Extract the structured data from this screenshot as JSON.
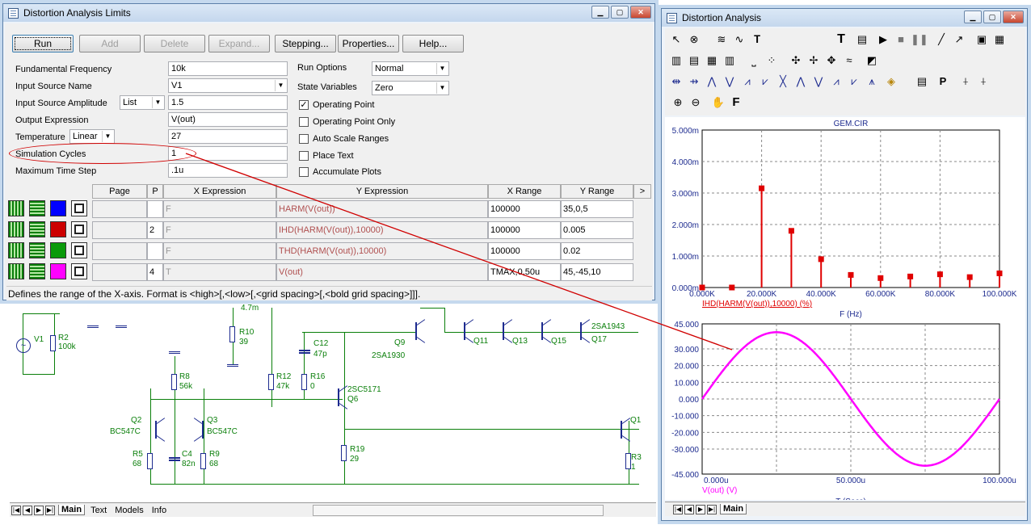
{
  "schematic": {
    "labels": {
      "v1": "V1",
      "r2": "R2",
      "r2v": "100k",
      "r10": "R10",
      "r10v": "39",
      "c12": "C12",
      "c12v": "47p",
      "r8": "R8",
      "r8v": "56k",
      "r12": "R12",
      "r12v": "47k",
      "r16": "R16",
      "r16v": "0",
      "q6": "2SC5171",
      "q6n": "Q6",
      "q9": "Q9",
      "q9v": "2SA1930",
      "q11": "Q11",
      "q13": "Q13",
      "q15": "Q15",
      "q17": "Q17",
      "q17v": "2SA1943",
      "q2": "Q2",
      "q2v": "BC547C",
      "q3": "Q3",
      "q3v": "BC547C",
      "r5": "R5",
      "r5v": "68",
      "c4": "C4",
      "c4v": "82n",
      "r9": "R9",
      "r9v": "68",
      "r19": "R19",
      "r19v": "29",
      "r3": "R3",
      "r3v": "1",
      "q1": "Q1",
      "r4p7": "4.7m"
    },
    "tabs": [
      "Main",
      "Text",
      "Models",
      "Info"
    ]
  },
  "dialog": {
    "title": "Distortion Analysis Limits",
    "buttons": {
      "run": "Run",
      "add": "Add",
      "delete": "Delete",
      "expand": "Expand...",
      "stepping": "Stepping...",
      "properties": "Properties...",
      "help": "Help..."
    },
    "fields": {
      "fundamental_frequency": {
        "label": "Fundamental Frequency",
        "value": "10k"
      },
      "input_source_name": {
        "label": "Input Source Name",
        "value": "V1"
      },
      "input_source_amplitude": {
        "label": "Input Source Amplitude",
        "mode": "List",
        "value": "1.5"
      },
      "output_expression": {
        "label": "Output Expression",
        "value": "V(out)"
      },
      "temperature": {
        "label": "Temperature",
        "mode": "Linear",
        "value": "27"
      },
      "simulation_cycles": {
        "label": "Simulation Cycles",
        "value": "1"
      },
      "maximum_time_step": {
        "label": "Maximum Time Step",
        "value": ".1u"
      }
    },
    "run_options": {
      "label": "Run Options",
      "value": "Normal"
    },
    "state_variables": {
      "label": "State Variables",
      "value": "Zero"
    },
    "checks": [
      {
        "label": "Operating Point",
        "checked": true
      },
      {
        "label": "Operating Point Only",
        "checked": false
      },
      {
        "label": "Auto Scale Ranges",
        "checked": false
      },
      {
        "label": "Place Text",
        "checked": false
      },
      {
        "label": "Accumulate Plots",
        "checked": false
      }
    ],
    "table": {
      "headers": [
        "Page",
        "P",
        "X Expression",
        "Y Expression",
        "X Range",
        "Y Range",
        ">"
      ],
      "rows": [
        {
          "color": "#0000ff",
          "page": "",
          "p": "",
          "x": "F",
          "y": "HARM(V(out))",
          "xr": "100000",
          "yr": "35,0,5"
        },
        {
          "color": "#cc0000",
          "page": "",
          "p": "2",
          "x": "F",
          "y": "IHD(HARM(V(out)),10000)",
          "xr": "100000",
          "yr": "0.005"
        },
        {
          "color": "#0a9a0a",
          "page": "",
          "p": "",
          "x": "F",
          "y": "THD(HARM(V(out)),10000)",
          "xr": "100000",
          "yr": "0.02"
        },
        {
          "color": "#ff00ff",
          "page": "",
          "p": "4",
          "x": "T",
          "y": "V(out)",
          "xr": "TMAX,0,50u",
          "yr": "45,-45,10"
        }
      ]
    },
    "status": "Defines the range of the X-axis. Format is <high>[,<low>[,<grid spacing>[,<bold grid spacing>]]]."
  },
  "plot_window": {
    "title": "Distortion Analysis",
    "tabs": [
      "Main"
    ],
    "top_plot": {
      "title": "GEM.CIR",
      "xlabel": "F (Hz)",
      "trace_label": "IHD(HARM(V(out)),10000) (%)",
      "yticks": [
        "0.000m",
        "1.000m",
        "2.000m",
        "3.000m",
        "4.000m",
        "5.000m"
      ],
      "xticks": [
        "0.000K",
        "20.000K",
        "40.000K",
        "60.000K",
        "80.000K",
        "100.000K"
      ]
    },
    "bottom_plot": {
      "xlabel": "T (Secs)",
      "trace_label": "V(out) (V)",
      "yticks": [
        "-45.000",
        "-30.000",
        "-20.000",
        "-10.000",
        "0.000",
        "10.000",
        "20.000",
        "30.000",
        "45.000"
      ],
      "xticks": [
        "0.000u",
        "50.000u",
        "100.000u"
      ]
    }
  },
  "chart_data": [
    {
      "type": "bar",
      "title": "GEM.CIR",
      "xlabel": "F (Hz)",
      "ylabel": "IHD(HARM(V(out)),10000) (%)",
      "x": [
        0,
        10000,
        20000,
        30000,
        40000,
        50000,
        60000,
        70000,
        80000,
        90000,
        100000
      ],
      "values": [
        5e-05,
        2e-05,
        3.15,
        1.8,
        0.9,
        0.4,
        0.3,
        0.35,
        0.42,
        0.33,
        0.45
      ],
      "xlim": [
        0,
        100000
      ],
      "ylim": [
        0,
        5
      ],
      "color": "#e00000",
      "grid": true
    },
    {
      "type": "line",
      "xlabel": "T (Secs)",
      "ylabel": "V(out) (V)",
      "series": [
        {
          "name": "V(out) (V)",
          "x": [
            0,
            5,
            10,
            15,
            20,
            25,
            30,
            35,
            40,
            45,
            50,
            55,
            60,
            65,
            70,
            75,
            80,
            85,
            90,
            95,
            100
          ],
          "values": [
            0,
            12.5,
            23.7,
            32.6,
            38.4,
            40,
            38.4,
            32.6,
            23.7,
            12.5,
            0,
            -12.5,
            -23.7,
            -32.6,
            -38.4,
            -40,
            -38.4,
            -32.6,
            -23.7,
            -12.5,
            0
          ]
        }
      ],
      "xlim": [
        0,
        100
      ],
      "ylim": [
        -45,
        45
      ],
      "color": "#ff00ff",
      "grid": true
    }
  ]
}
